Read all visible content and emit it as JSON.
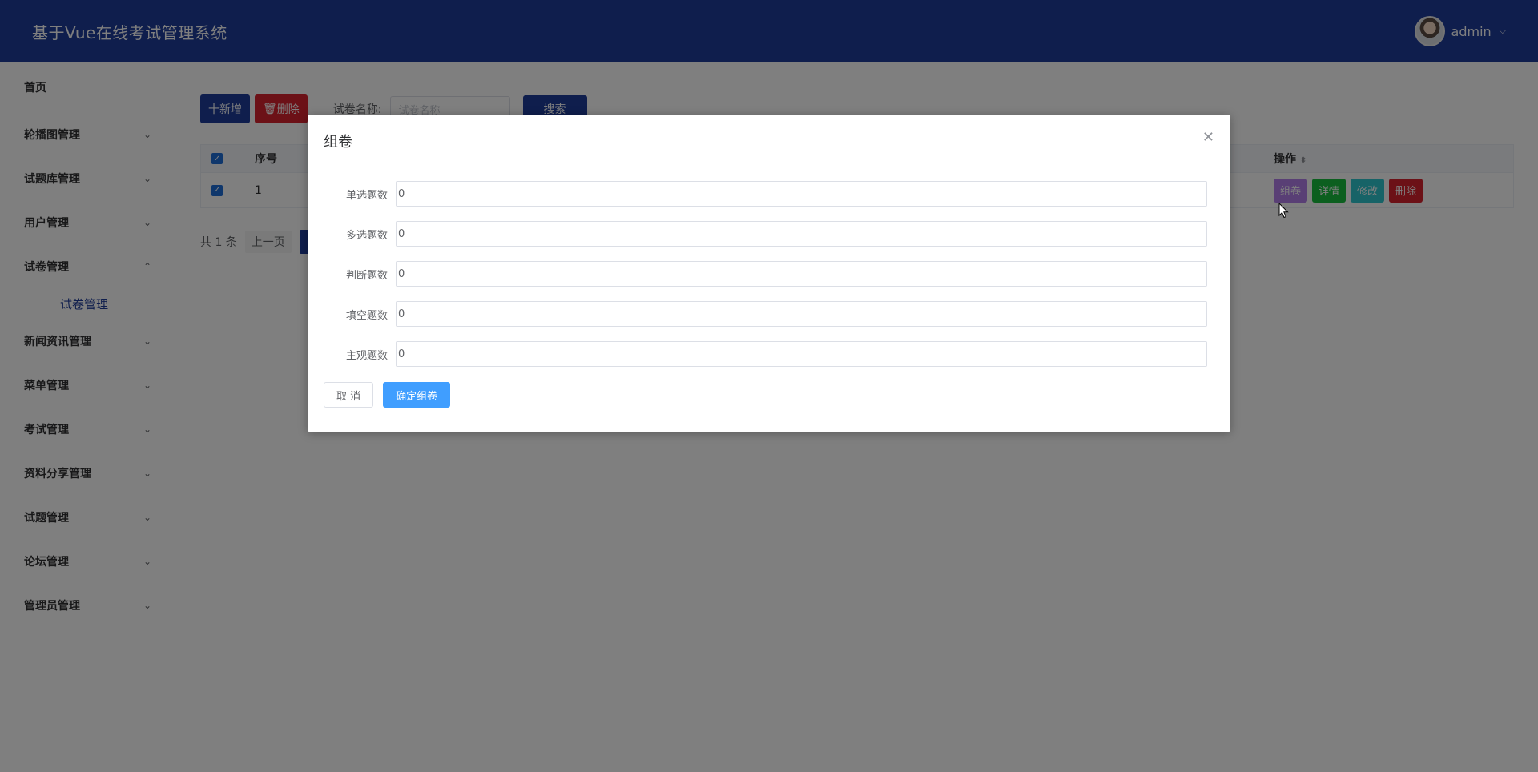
{
  "header": {
    "title": "基于Vue在线考试管理系统",
    "user_name": "admin",
    "caret_icon": "chevron-down-icon"
  },
  "sidebar": {
    "items": [
      {
        "label": "首页",
        "expandable": false
      },
      {
        "label": "轮播图管理",
        "expandable": true
      },
      {
        "label": "试题库管理",
        "expandable": true
      },
      {
        "label": "用户管理",
        "expandable": true
      },
      {
        "label": "试卷管理",
        "expandable": true,
        "expanded": true
      },
      {
        "label": "新闻资讯管理",
        "expandable": true
      },
      {
        "label": "菜单管理",
        "expandable": true
      },
      {
        "label": "考试管理",
        "expandable": true
      },
      {
        "label": "资料分享管理",
        "expandable": true
      },
      {
        "label": "试题管理",
        "expandable": true
      },
      {
        "label": "论坛管理",
        "expandable": true
      },
      {
        "label": "管理员管理",
        "expandable": true
      }
    ],
    "subitem_active": "试卷管理"
  },
  "toolbar": {
    "add_label": "十新增",
    "delete_label": "删除",
    "search_label": "试卷名称:",
    "search_placeholder": "试卷名称",
    "search_button": "搜索"
  },
  "table": {
    "headers": {
      "index": "序号",
      "ops": "操作"
    },
    "rows": [
      {
        "index": "1"
      }
    ],
    "row_actions": [
      "组卷",
      "详情",
      "修改",
      "删除"
    ]
  },
  "pager": {
    "total": "共 1 条",
    "prev": "上一页"
  },
  "dialog": {
    "title": "组卷",
    "fields": [
      {
        "label": "单选题数",
        "value": "0"
      },
      {
        "label": "多选题数",
        "value": "0"
      },
      {
        "label": "判断题数",
        "value": "0"
      },
      {
        "label": "填空题数",
        "value": "0"
      },
      {
        "label": "主观题数",
        "value": "0"
      }
    ],
    "cancel": "取 消",
    "confirm": "确定组卷",
    "close_icon": "close-icon"
  },
  "colors": {
    "brand": "#1e3c9a",
    "danger": "#d9232e",
    "primary": "#409eff",
    "success": "#19be3e",
    "info": "#2ec6ce",
    "purple": "#b37feb"
  }
}
